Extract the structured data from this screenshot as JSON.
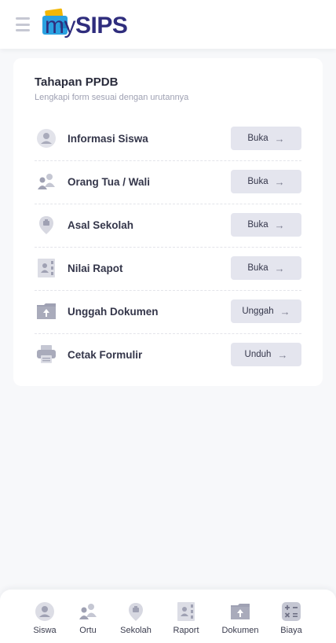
{
  "header": {
    "menu_icon": "hamburger-icon",
    "logo_my": "my",
    "logo_sips": "SIPS"
  },
  "card": {
    "title": "Tahapan PPDB",
    "subtitle": "Lengkapi form sesuai dengan urutannya",
    "steps": [
      {
        "label": "Informasi Siswa",
        "button": "Buka",
        "icon": "user-icon"
      },
      {
        "label": "Orang Tua / Wali",
        "button": "Buka",
        "icon": "parents-icon"
      },
      {
        "label": "Asal Sekolah",
        "button": "Buka",
        "icon": "school-badge-icon"
      },
      {
        "label": "Nilai Rapot",
        "button": "Buka",
        "icon": "report-book-icon"
      },
      {
        "label": "Unggah Dokumen",
        "button": "Unggah",
        "icon": "upload-folder-icon"
      },
      {
        "label": "Cetak Formulir",
        "button": "Unduh",
        "icon": "printer-icon"
      }
    ]
  },
  "bottom_nav": {
    "items": [
      {
        "label": "Siswa",
        "icon": "user-icon"
      },
      {
        "label": "Ortu",
        "icon": "parents-icon"
      },
      {
        "label": "Sekolah",
        "icon": "school-badge-icon"
      },
      {
        "label": "Raport",
        "icon": "report-book-icon"
      },
      {
        "label": "Dokumen",
        "icon": "upload-folder-icon"
      },
      {
        "label": "Biaya",
        "icon": "calculator-icon"
      }
    ]
  },
  "colors": {
    "background": "#f7f8fa",
    "brand": "#2f2d7d",
    "button": "#e4e5ee",
    "icon": "#b9bbc8"
  }
}
